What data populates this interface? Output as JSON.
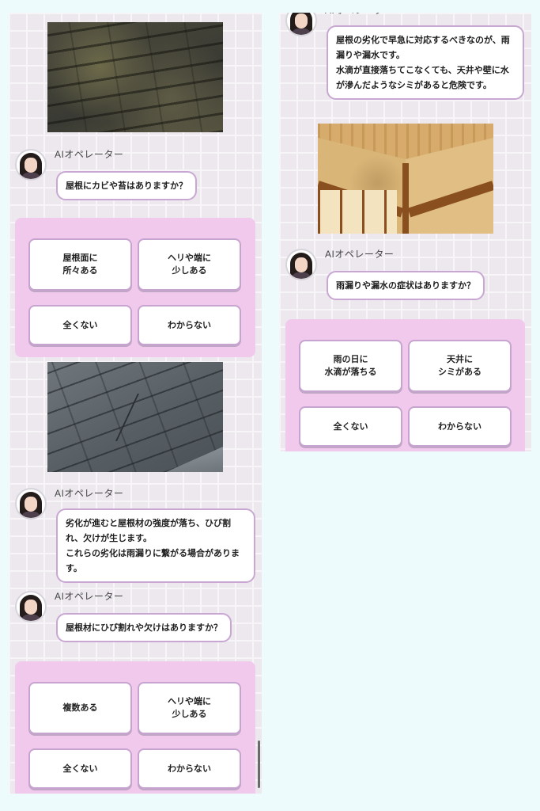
{
  "operator": {
    "name": "AIオペレーター"
  },
  "left": {
    "q1": {
      "message": "屋根にカビや苔はありますか？",
      "choices": [
        "屋根面に\n所々ある",
        "ヘリや端に\n少しある",
        "全くない",
        "わからない"
      ]
    },
    "info": {
      "line1": "劣化が進むと屋根材の強度が落ち、ひび割れ、欠けが生じます。",
      "line2": "これらの劣化は雨漏りに繋がる場合があります。"
    },
    "q2": {
      "message": "屋根材にひび割れや欠けはありますか？",
      "choices": [
        "複数ある",
        "ヘリや端に\n少しある",
        "全くない",
        "わからない"
      ]
    }
  },
  "right": {
    "info": {
      "line1": "屋根の劣化で早急に対応するべきなのが、雨漏りや漏水です。",
      "line2": "水滴が直接落ちてこなくても、天井や壁に水が滲んだようなシミがあると危険です。"
    },
    "q3": {
      "message": "雨漏りや漏水の症状はありますか？",
      "choices": [
        "雨の日に\n水滴が落ちる",
        "天井に\nシミがある",
        "全くない",
        "わからない"
      ]
    }
  }
}
